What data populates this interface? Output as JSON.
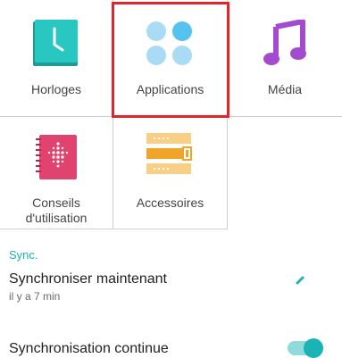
{
  "tiles": {
    "clocks": {
      "label": "Horloges",
      "icon": "clock-icon"
    },
    "apps": {
      "label": "Applications",
      "icon": "apps-grid-icon"
    },
    "media": {
      "label": "Média",
      "icon": "music-note-icon"
    },
    "tips": {
      "label_line1": "Conseils",
      "label_line2": "d'utilisation",
      "icon": "notebook-icon"
    },
    "accessories": {
      "label": "Accessoires",
      "icon": "band-icon"
    }
  },
  "sync": {
    "section_title": "Sync.",
    "sync_now_title": "Synchroniser maintenant",
    "sync_now_sub": "il y a 7 min",
    "continuous_title": "Synchronisation continue",
    "continuous_toggle": "on"
  },
  "colors": {
    "accent": "#1bb3b3",
    "highlight": "#e0262d",
    "clock": "#27c7c1",
    "apps": "#7dc9f0",
    "media": "#a44ad1",
    "tips": "#e0436e",
    "accessories": "#f6b13f"
  }
}
